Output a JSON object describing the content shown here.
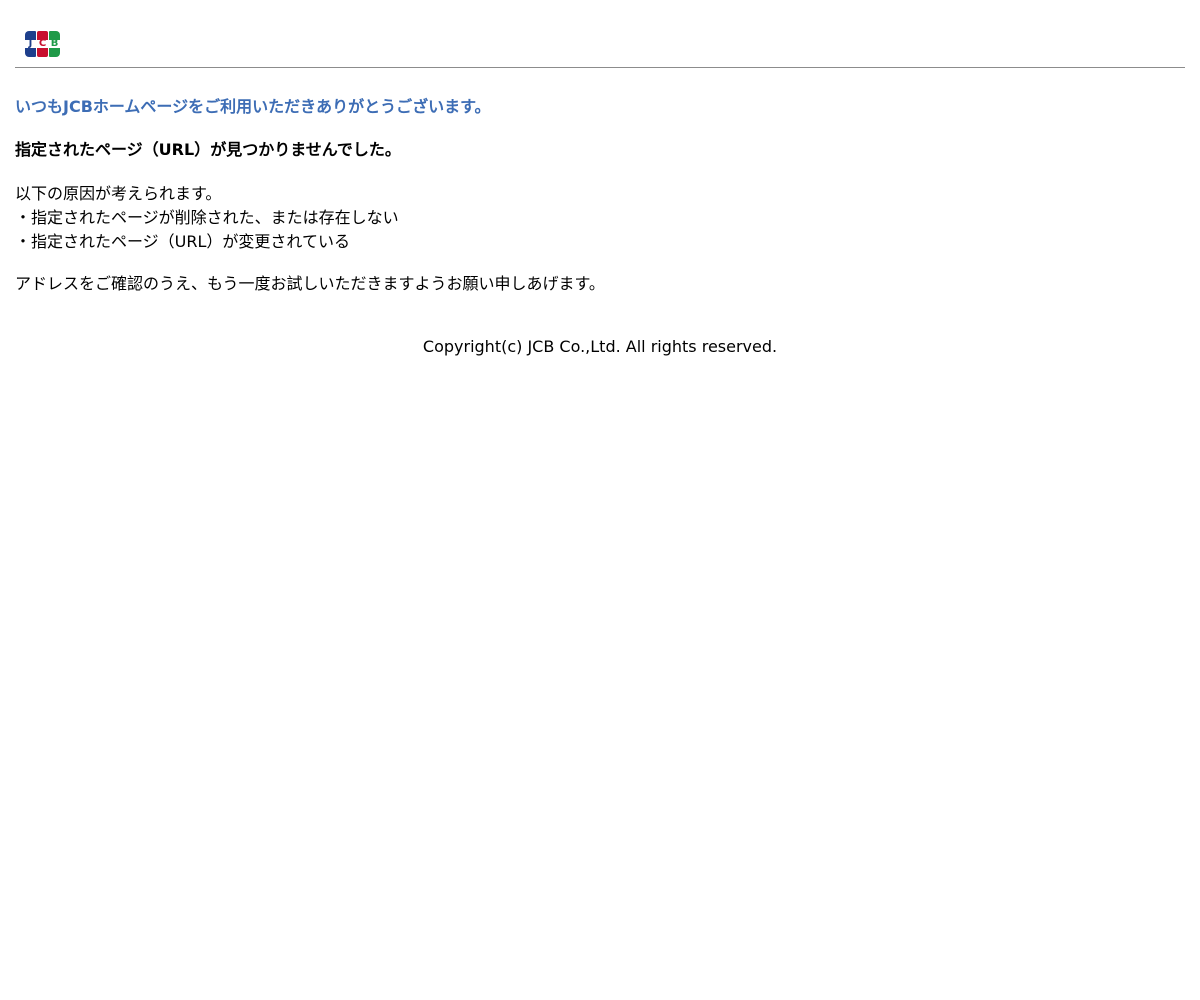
{
  "header": {
    "logo": {
      "icon": "jcb-logo-icon",
      "letters": [
        "J",
        "C",
        "B"
      ],
      "colors": [
        "#1e3f8c",
        "#c8102e",
        "#1f9a48"
      ]
    }
  },
  "main": {
    "greeting": "いつもJCBホームページをご利用いただきありがとうございます。",
    "not_found": "指定されたページ（URL）が見つかりませんでした。",
    "causes_intro": "以下の原因が考えられます。",
    "causes": [
      "・指定されたページが削除された、または存在しない",
      "・指定されたページ（URL）が変更されている"
    ],
    "advice": "アドレスをご確認のうえ、もう一度お試しいただきますようお願い申しあげます。"
  },
  "footer": {
    "copyright": "Copyright(c) JCB Co.,Ltd. All rights reserved."
  },
  "colors": {
    "accent": "#3d6db5",
    "divider": "#8c8c8c"
  }
}
